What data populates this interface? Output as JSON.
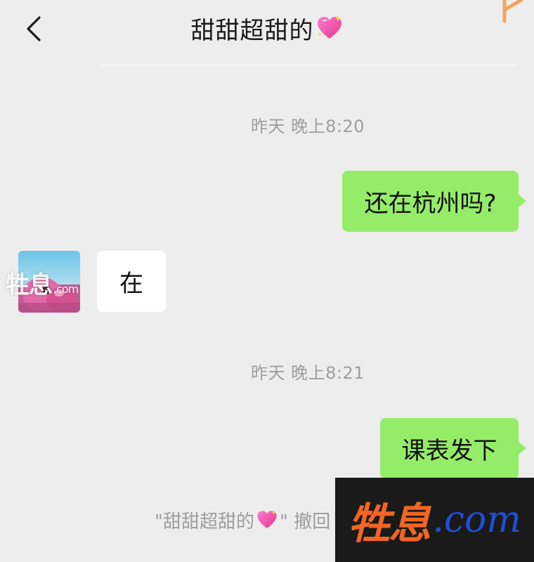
{
  "header": {
    "title": "甜甜超甜的",
    "title_emoji": "sparkling-heart-icon"
  },
  "messages": [
    {
      "kind": "timestamp",
      "text": "昨天 晚上8:20"
    },
    {
      "kind": "outgoing",
      "text": "还在杭州吗?"
    },
    {
      "kind": "incoming",
      "text": "在"
    },
    {
      "kind": "timestamp",
      "text": "昨天 晚上8:21"
    },
    {
      "kind": "outgoing",
      "text": "课表发下"
    }
  ],
  "recall_notice": {
    "prefix": "\"甜甜超甜的",
    "suffix": "\" 撤回"
  },
  "watermark": {
    "brand_cn": "牲息",
    "brand_en": ".com",
    "brand_en_small": ".com"
  },
  "colors": {
    "background": "#ededed",
    "outgoing_bubble": "#95ec69",
    "incoming_bubble": "#ffffff",
    "timestamp_text": "#9e9e9e",
    "watermark_orange": "#f26522",
    "watermark_blue": "#1f4ed8"
  }
}
